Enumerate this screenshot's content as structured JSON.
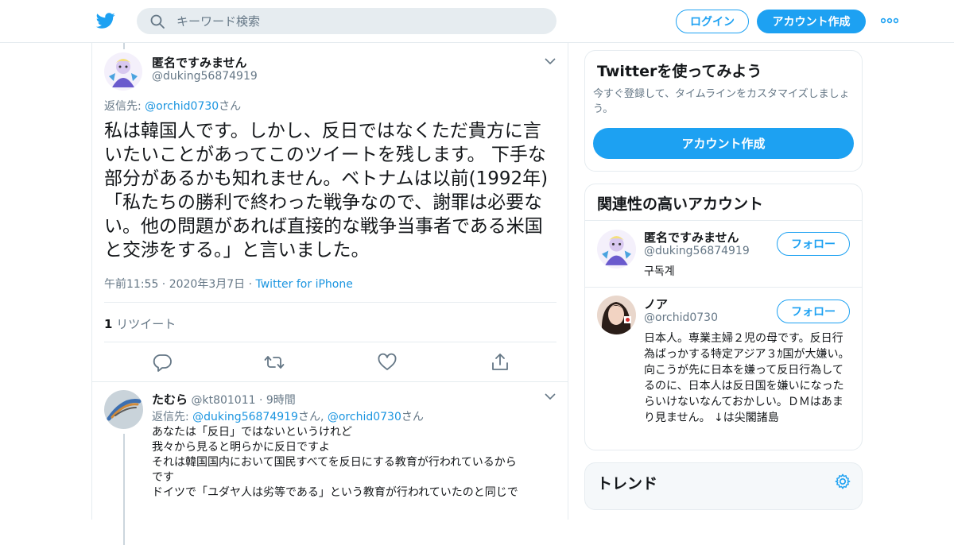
{
  "header": {
    "search_placeholder": "キーワード検索",
    "login_label": "ログイン",
    "signup_label": "アカウント作成",
    "accent": "#1da1f2"
  },
  "tweet": {
    "name": "匿名ですみません",
    "handle": "@duking56874919",
    "reply_prefix": "返信先: ",
    "reply_to": "@orchid0730",
    "reply_suffix": "さん",
    "text": "私は韓国人です。しかし、反日ではなくただ貴方に言いたいことがあってこのツイートを残します。 下手な部分があるかも知れません。ベトナムは以前(1992年)「私たちの勝利で終わった戦争なので、謝罪は必要ない。他の問題があれば直接的な戦争当事者である米国と交渉をする。」と言いました。",
    "time": "午前11:55 · 2020年3月7日 · ",
    "source": "Twitter for iPhone",
    "retweet_count": "1",
    "retweet_label": " リツイート"
  },
  "reply": {
    "name": "たむら",
    "handle": "@kt801011",
    "time": " · 9時間",
    "reply_prefix": "返信先: ",
    "reply_to1": "@duking56874919",
    "reply_mid": "さん, ",
    "reply_to2": "@orchid0730",
    "reply_suffix": "さん",
    "lines": [
      "あなたは「反日」ではないというけれど",
      "我々から見ると明らかに反日ですよ",
      "それは韓国国内において国民すべてを反日にする教育が行われているから",
      "です",
      "ドイツで「ユダヤ人は劣等である」という教育が行われていたのと同じで"
    ]
  },
  "sidebar": {
    "signup_card": {
      "title": "Twitterを使ってみよう",
      "subtitle": "今すぐ登録して、タイムラインをカスタマイズしましょう。",
      "button": "アカウント作成"
    },
    "related": {
      "title": "関連性の高いアカウント",
      "follow_label": "フォロー",
      "accounts": [
        {
          "name": "匿名ですみません",
          "handle": "@duking56874919",
          "bio": "구독계"
        },
        {
          "name": "ノア",
          "handle": "@orchid0730",
          "bio": "日本人。専業主婦２児の母です。反日行為ばっかする特定アジア３ｶ国が大嫌い。向こうが先に日本を嫌って反日行為してるのに、日本人は反日国を嫌いになったらいけないなんておかしい。ＤＭはあまり見ません。 ↓は尖閣諸島"
        }
      ]
    },
    "trends": {
      "title": "トレンド"
    }
  }
}
